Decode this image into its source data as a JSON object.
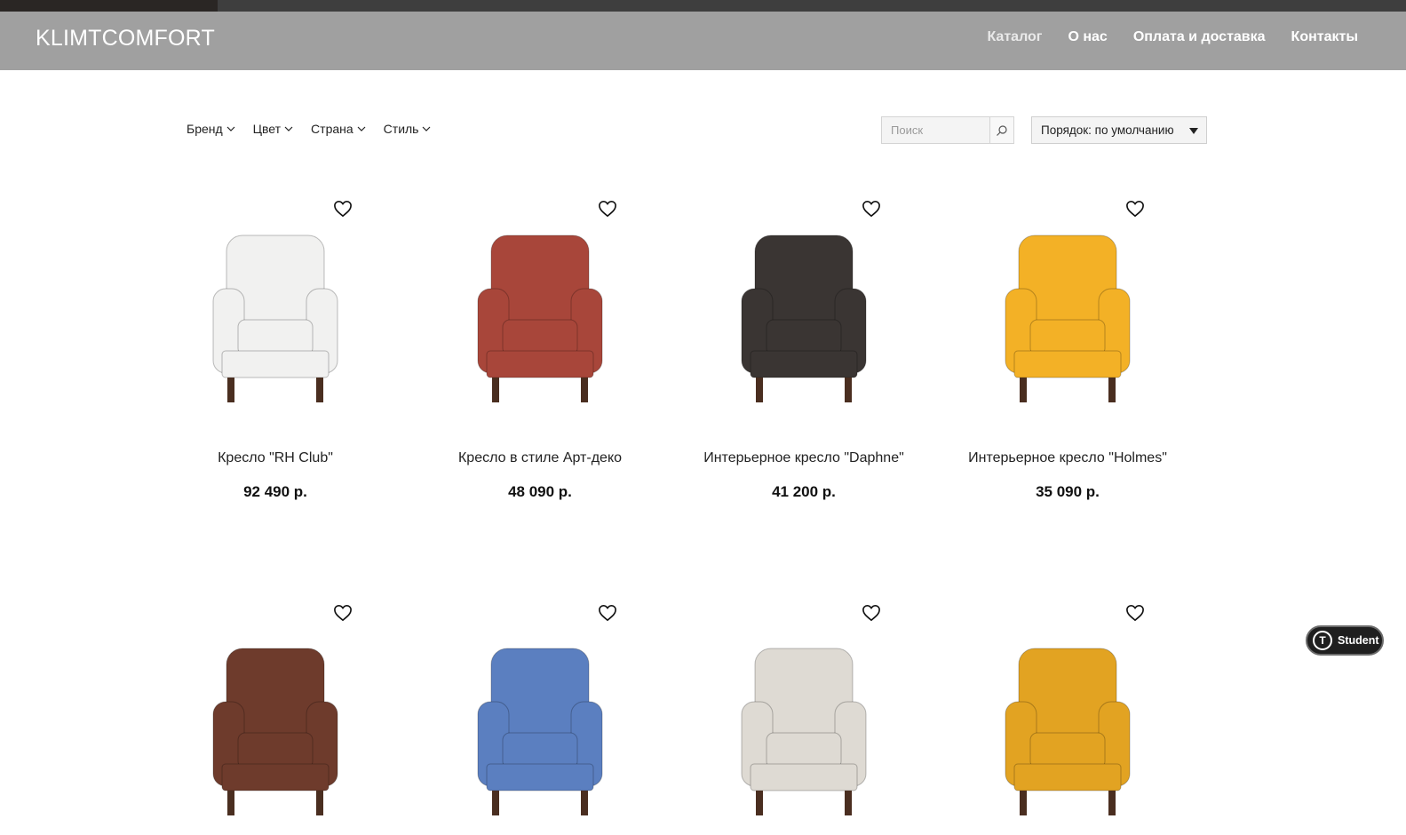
{
  "header": {
    "logo": "KLIMTCOMFORT",
    "nav": [
      {
        "label": "Каталог",
        "active": true
      },
      {
        "label": "О нас"
      },
      {
        "label": "Оплата и доставка"
      },
      {
        "label": "Контакты"
      }
    ]
  },
  "filters": {
    "items": [
      "Бренд",
      "Цвет",
      "Страна",
      "Стиль"
    ],
    "search_placeholder": "Поиск",
    "sort_label": "Порядок: по умолчанию"
  },
  "products": [
    {
      "name": "Кресло \"RH Club\"",
      "price": "92 490 р.",
      "color": "#f1f1f0"
    },
    {
      "name": "Кресло в стиле Арт-деко",
      "price": "48 090 р.",
      "color": "#a8463a"
    },
    {
      "name": "Интерьерное кресло \"Daphne\"",
      "price": "41 200 р.",
      "color": "#3a3533"
    },
    {
      "name": "Интерьерное кресло \"Holmes\"",
      "price": "35 090 р.",
      "color": "#f3b126"
    },
    {
      "color": "#6e3b2c"
    },
    {
      "color": "#5b7fc0"
    },
    {
      "color": "#dedad3"
    },
    {
      "color": "#e2a322"
    }
  ],
  "badge": {
    "label": "Student",
    "icon": "tilda-logo-icon"
  }
}
